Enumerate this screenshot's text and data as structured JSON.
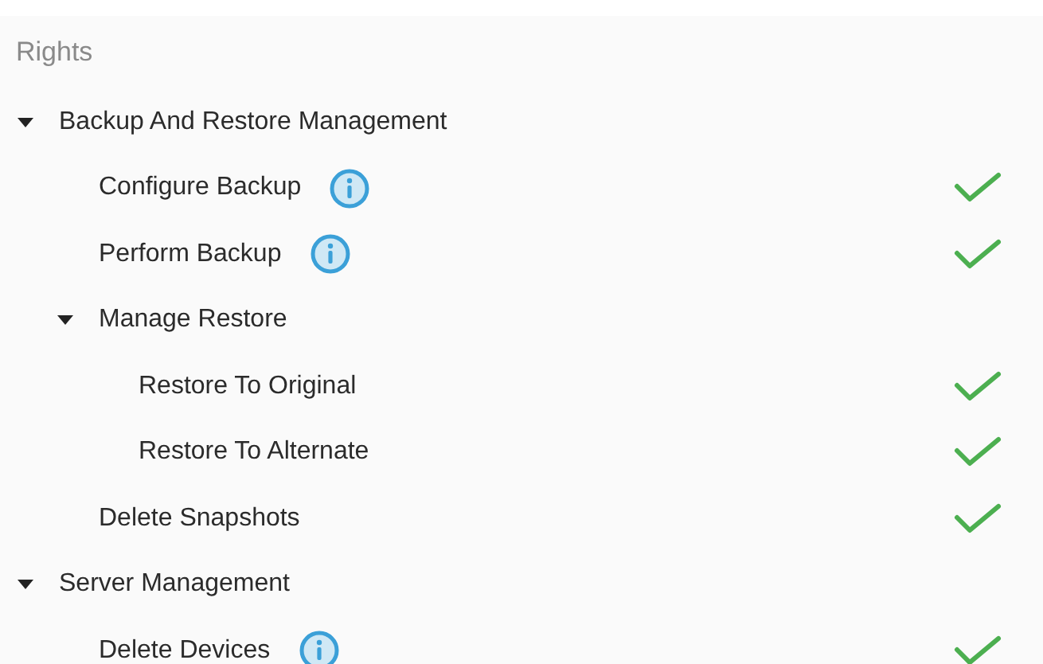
{
  "title": "Rights",
  "tree": [
    {
      "label": "Backup And Restore Management",
      "expanded": true,
      "children": [
        {
          "label": "Configure Backup",
          "info": true,
          "granted": true
        },
        {
          "label": "Perform Backup",
          "info": true,
          "granted": true
        },
        {
          "label": "Manage Restore",
          "expanded": true,
          "children": [
            {
              "label": "Restore To Original",
              "info": false,
              "granted": true
            },
            {
              "label": "Restore To Alternate",
              "info": false,
              "granted": true
            }
          ]
        },
        {
          "label": "Delete Snapshots",
          "info": false,
          "granted": true
        }
      ]
    },
    {
      "label": "Server Management",
      "expanded": true,
      "children": [
        {
          "label": "Delete Devices",
          "info": true,
          "granted": true
        }
      ]
    }
  ]
}
